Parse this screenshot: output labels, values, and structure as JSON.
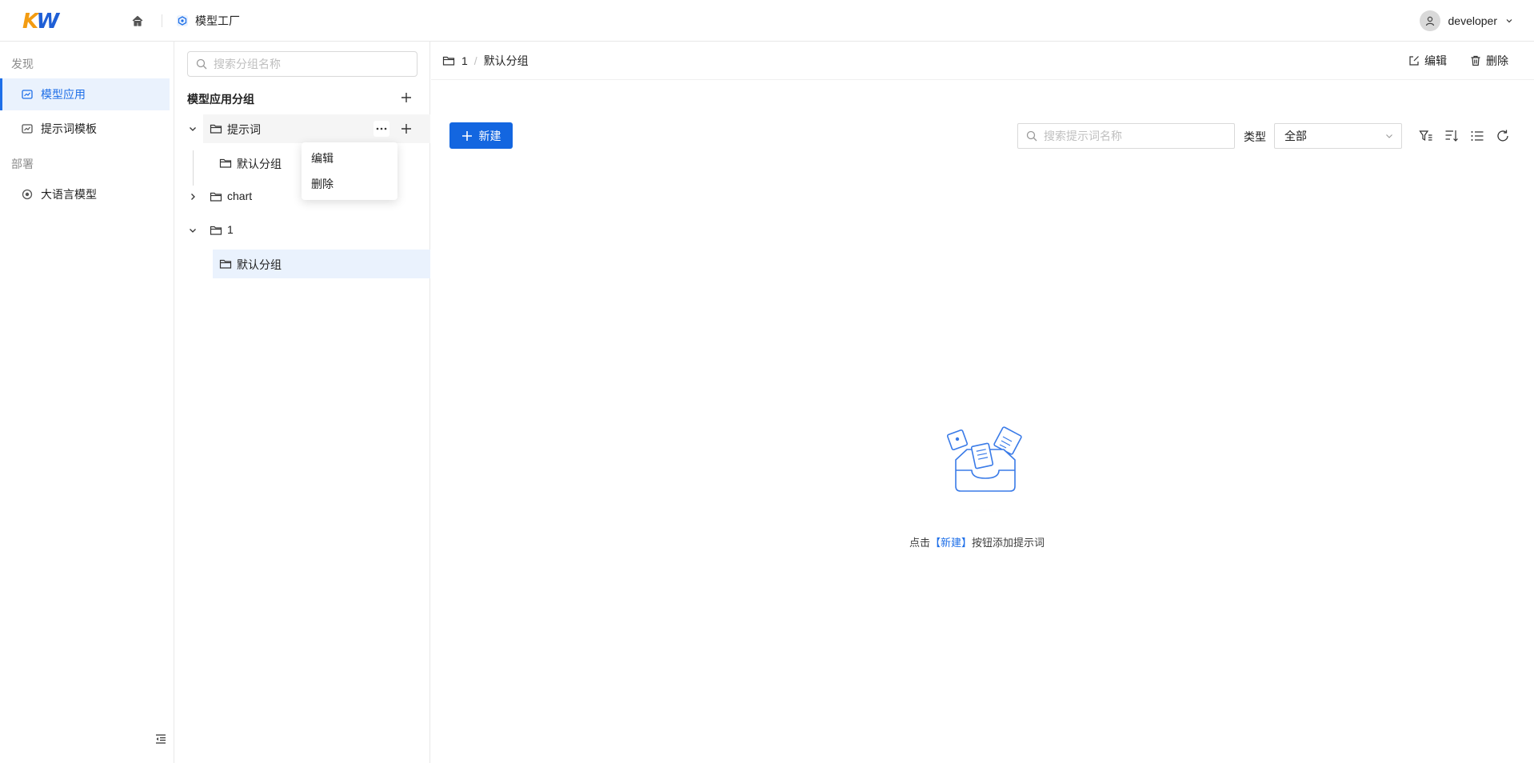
{
  "header": {
    "logo_text": "KW",
    "app_name": "模型工厂",
    "user_name": "developer"
  },
  "leftnav": {
    "sections": [
      {
        "label": "发现",
        "items": [
          {
            "label": "模型应用",
            "active": true
          },
          {
            "label": "提示词模板",
            "active": false
          }
        ]
      },
      {
        "label": "部署",
        "items": [
          {
            "label": "大语言模型",
            "active": false
          }
        ]
      }
    ]
  },
  "grouppanel": {
    "search_placeholder": "搜索分组名称",
    "title": "模型应用分组",
    "tree": [
      {
        "label": "提示词",
        "expanded": true,
        "children": [
          {
            "label": "默认分组"
          }
        ]
      },
      {
        "label": "chart",
        "expanded": false,
        "children": []
      },
      {
        "label": "1",
        "expanded": true,
        "children": [
          {
            "label": "默认分组",
            "selected": true
          }
        ]
      }
    ],
    "context_menu": [
      "编辑",
      "删除"
    ]
  },
  "main": {
    "breadcrumb": [
      "1",
      "默认分组"
    ],
    "breadcrumb_sep": "/",
    "actions": {
      "edit": "编辑",
      "delete": "删除"
    },
    "new_button": "新建",
    "search_placeholder": "搜索提示词名称",
    "type_label": "类型",
    "type_value": "全部",
    "empty": {
      "prefix": "点击",
      "link": "【新建】",
      "suffix": "按钮添加提示词"
    }
  },
  "colors": {
    "primary": "#1366e0",
    "accent_orange": "#f39c12",
    "active_bg": "#eaf2fd"
  }
}
